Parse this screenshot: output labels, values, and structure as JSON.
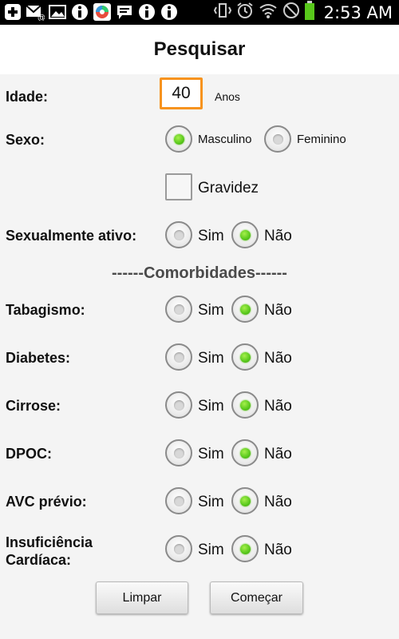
{
  "status_bar": {
    "time": "2:53 AM",
    "left_icons": [
      "plus-icon",
      "email-icon",
      "image-icon",
      "info-icon",
      "app-icon",
      "chat-icon",
      "info-icon",
      "info-icon"
    ],
    "right_icons": [
      "vibrate-icon",
      "alarm-icon",
      "wifi-icon",
      "no-signal-icon",
      "battery-icon"
    ]
  },
  "title": "Pesquisar",
  "age": {
    "label": "Idade:",
    "value": "40",
    "unit": "Anos"
  },
  "sex": {
    "label": "Sexo:",
    "options": [
      "Masculino",
      "Feminino"
    ],
    "selected": "Masculino"
  },
  "pregnancy": {
    "label": "Gravidez",
    "checked": false
  },
  "sexually_active": {
    "label": "Sexualmente ativo:",
    "yes": "Sim",
    "no": "Não",
    "selected": "Não"
  },
  "comorbidities_header": "------Comorbidades------",
  "comorbidities": [
    {
      "label": "Tabagismo:",
      "yes": "Sim",
      "no": "Não",
      "selected": "Não"
    },
    {
      "label": "Diabetes:",
      "yes": "Sim",
      "no": "Não",
      "selected": "Não"
    },
    {
      "label": "Cirrose:",
      "yes": "Sim",
      "no": "Não",
      "selected": "Não"
    },
    {
      "label": "DPOC:",
      "yes": "Sim",
      "no": "Não",
      "selected": "Não"
    },
    {
      "label": "AVC prévio:",
      "yes": "Sim",
      "no": "Não",
      "selected": "Não"
    },
    {
      "label_line1": "Insuficiência",
      "label_line2": "Cardíaca:",
      "yes": "Sim",
      "no": "Não",
      "selected": "Não"
    }
  ],
  "buttons": {
    "clear": "Limpar",
    "start": "Começar"
  }
}
